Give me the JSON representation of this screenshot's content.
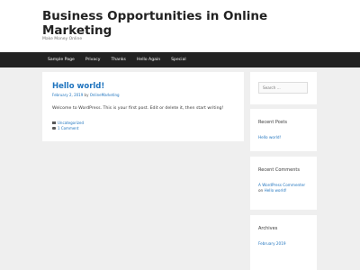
{
  "header": {
    "site_title": "Business Opportunities in Online Marketing",
    "tagline": "Make Money Online"
  },
  "nav": {
    "items": [
      {
        "label": "Sample Page"
      },
      {
        "label": "Privacy"
      },
      {
        "label": "Thanks"
      },
      {
        "label": "Hello Again"
      },
      {
        "label": "Special"
      }
    ]
  },
  "post": {
    "title": "Hello world!",
    "date": "February 2, 2019",
    "by": "by",
    "author": "OnlineMarketing",
    "body": "Welcome to WordPress. This is your first post. Edit or delete it, then start writing!",
    "category": "Uncategorized",
    "comments": "1 Comment"
  },
  "sidebar": {
    "search": {
      "placeholder": "Search ..."
    },
    "recent_posts": {
      "title": "Recent Posts",
      "items": [
        "Hello world!"
      ]
    },
    "recent_comments": {
      "title": "Recent Comments",
      "author": "A WordPress Commenter",
      "on": "on",
      "post": "Hello world!"
    },
    "archives": {
      "title": "Archives",
      "items": [
        "February 2019"
      ]
    }
  },
  "colors": {
    "background": "#efefef",
    "nav_bar": "#222222",
    "link": "#1e73be",
    "card": "#ffffff"
  }
}
